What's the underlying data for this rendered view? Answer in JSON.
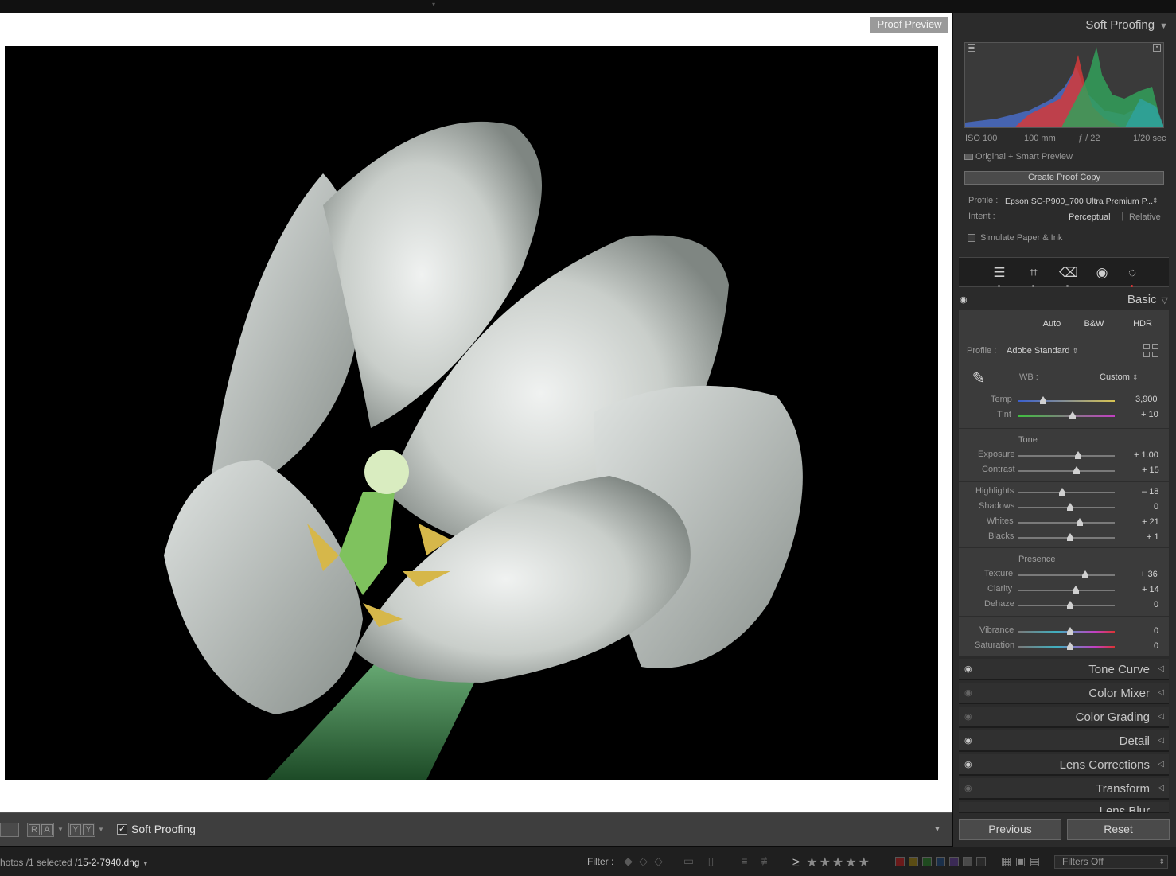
{
  "canvas": {
    "badge": "Proof Preview"
  },
  "toolbar": {
    "view_pair_1": [
      "R",
      "A"
    ],
    "view_pair_2": [
      "Y",
      "Y"
    ],
    "soft_proofing_label": "Soft Proofing",
    "soft_proofing_checked": true
  },
  "filmstrip": {
    "path_prefix": "hotos /1 selected /",
    "file_name": "15-2-7940.dng",
    "filter_label": "Filter :",
    "rating_op": "≥",
    "stars": "★★★★★",
    "filters_select": "Filters Off",
    "swatches": [
      "#6b1a1a",
      "#5a4c14",
      "#1f4a1f",
      "#1a2f4a",
      "#3b2a55",
      "#4a4a4a",
      "#2a2a2a"
    ]
  },
  "soft_proofing": {
    "title": "Soft Proofing",
    "exif": {
      "iso": "ISO 100",
      "focal": "100 mm",
      "aperture": "ƒ / 22",
      "shutter": "1/20 sec"
    },
    "preview_mode": "Original + Smart Preview",
    "create_proof_copy": "Create Proof Copy",
    "profile_label": "Profile :",
    "profile_value": "Epson SC-P900_700 Ultra Premium P...",
    "intent_label": "Intent :",
    "intent_options": [
      "Perceptual",
      "Relative"
    ],
    "intent_selected": "Perceptual",
    "simulate_label": "Simulate Paper & Ink"
  },
  "basic": {
    "title": "Basic",
    "buttons": [
      "Auto",
      "B&W",
      "HDR"
    ],
    "profile_label": "Profile :",
    "profile_value": "Adobe Standard",
    "wb_label": "WB :",
    "wb_value": "Custom",
    "temp": {
      "label": "Temp",
      "value": "3,900",
      "level": 0.22
    },
    "tint": {
      "label": "Tint",
      "value": "+ 10",
      "level": 0.53
    },
    "tone_title": "Tone",
    "tone": [
      {
        "label": "Exposure",
        "value": "+ 1.00",
        "level": 0.59
      },
      {
        "label": "Contrast",
        "value": "+ 15",
        "level": 0.57
      },
      {
        "label": "Highlights",
        "value": "– 18",
        "level": 0.42
      },
      {
        "label": "Shadows",
        "value": "0",
        "level": 0.5
      },
      {
        "label": "Whites",
        "value": "+ 21",
        "level": 0.6
      },
      {
        "label": "Blacks",
        "value": "+ 1",
        "level": 0.5
      }
    ],
    "presence_title": "Presence",
    "presence": [
      {
        "label": "Texture",
        "value": "+ 36",
        "level": 0.66
      },
      {
        "label": "Clarity",
        "value": "+ 14",
        "level": 0.56
      },
      {
        "label": "Dehaze",
        "value": "0",
        "level": 0.5
      },
      {
        "label": "Vibrance",
        "value": "0",
        "level": 0.5
      },
      {
        "label": "Saturation",
        "value": "0",
        "level": 0.5
      }
    ]
  },
  "collapsed_panels": [
    "Tone Curve",
    "Color Mixer",
    "Color Grading",
    "Detail",
    "Lens Corrections",
    "Transform",
    "Lens Blur"
  ],
  "bottom_buttons": {
    "previous": "Previous",
    "reset": "Reset"
  }
}
